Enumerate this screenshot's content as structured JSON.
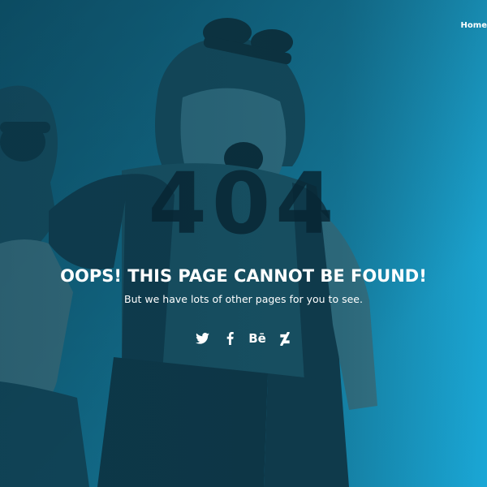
{
  "nav": {
    "home_label": "Home"
  },
  "error": {
    "code": "404",
    "title": "OOPS! THIS PAGE CANNOT BE FOUND!",
    "subtitle": "But we have lots of other pages for you to see."
  },
  "social": {
    "items": [
      {
        "icon": "twitter-icon"
      },
      {
        "icon": "facebook-icon"
      },
      {
        "icon": "behance-icon",
        "glyph": "Bē"
      },
      {
        "icon": "deviantart-icon"
      }
    ]
  },
  "colors": {
    "background_start": "#0f5f7b",
    "background_end": "#1aa7d6",
    "code_color": "#072432",
    "text_color": "#ffffff"
  }
}
